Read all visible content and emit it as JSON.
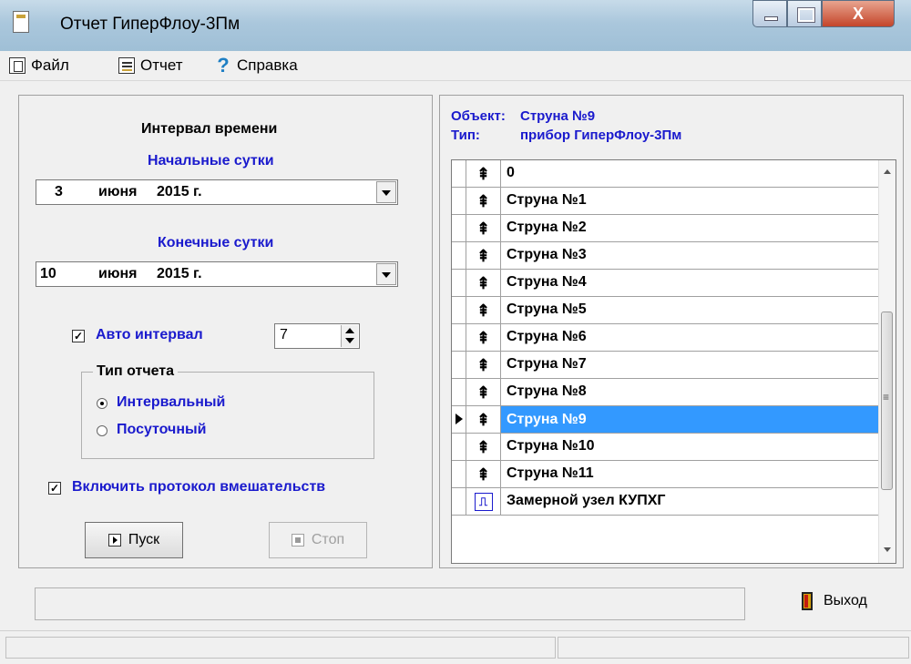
{
  "window": {
    "title": "Отчет ГиперФлоу-3Пм",
    "close_glyph": "X"
  },
  "menu": [
    {
      "label": "Файл",
      "icon": "file-icon"
    },
    {
      "label": "Отчет",
      "icon": "report-icon"
    },
    {
      "label": "Справка",
      "icon": "help-icon"
    }
  ],
  "left": {
    "interval_title": "Интервал времени",
    "start_label": "Начальные сутки",
    "start_date": {
      "day": "3",
      "month": "июня",
      "year": "2015 г."
    },
    "end_label": "Конечные сутки",
    "end_date": {
      "day": "10",
      "month": "июня",
      "year": "2015 г."
    },
    "auto_interval_label": "Авто интервал",
    "auto_interval_checked": true,
    "auto_interval_value": "7",
    "report_type_label": "Тип отчета",
    "report_type_options": [
      "Интервальный",
      "Посуточный"
    ],
    "report_type_selected": "Интервальный",
    "protocol_label": "Включить протокол вмешательств",
    "protocol_checked": true,
    "start_button": "Пуск",
    "stop_button": "Стоп",
    "check_mark": "✓"
  },
  "right": {
    "object_key": "Объект:",
    "object_value": "Струна №9",
    "type_key": "Тип:",
    "type_value": "прибор ГиперФлоу-3Пм",
    "valve_glyph": "⇞",
    "node_glyph": "⎍",
    "items": [
      {
        "label": "0",
        "icon": "valve"
      },
      {
        "label": "Струна №1",
        "icon": "valve"
      },
      {
        "label": "Струна №2",
        "icon": "valve"
      },
      {
        "label": "Струна №3",
        "icon": "valve"
      },
      {
        "label": "Струна №4",
        "icon": "valve"
      },
      {
        "label": "Струна №5",
        "icon": "valve"
      },
      {
        "label": "Струна №6",
        "icon": "valve"
      },
      {
        "label": "Струна №7",
        "icon": "valve"
      },
      {
        "label": "Струна №8",
        "icon": "valve"
      },
      {
        "label": "Струна №9",
        "icon": "valve"
      },
      {
        "label": "Струна №10",
        "icon": "valve"
      },
      {
        "label": "Струна №11",
        "icon": "valve"
      },
      {
        "label": "Замерной узел КУПХГ",
        "icon": "node"
      }
    ],
    "selected_index": 9
  },
  "footer": {
    "exit_label": "Выход"
  },
  "colors": {
    "accent_blue": "#1a1acd",
    "selection": "#3399ff"
  }
}
